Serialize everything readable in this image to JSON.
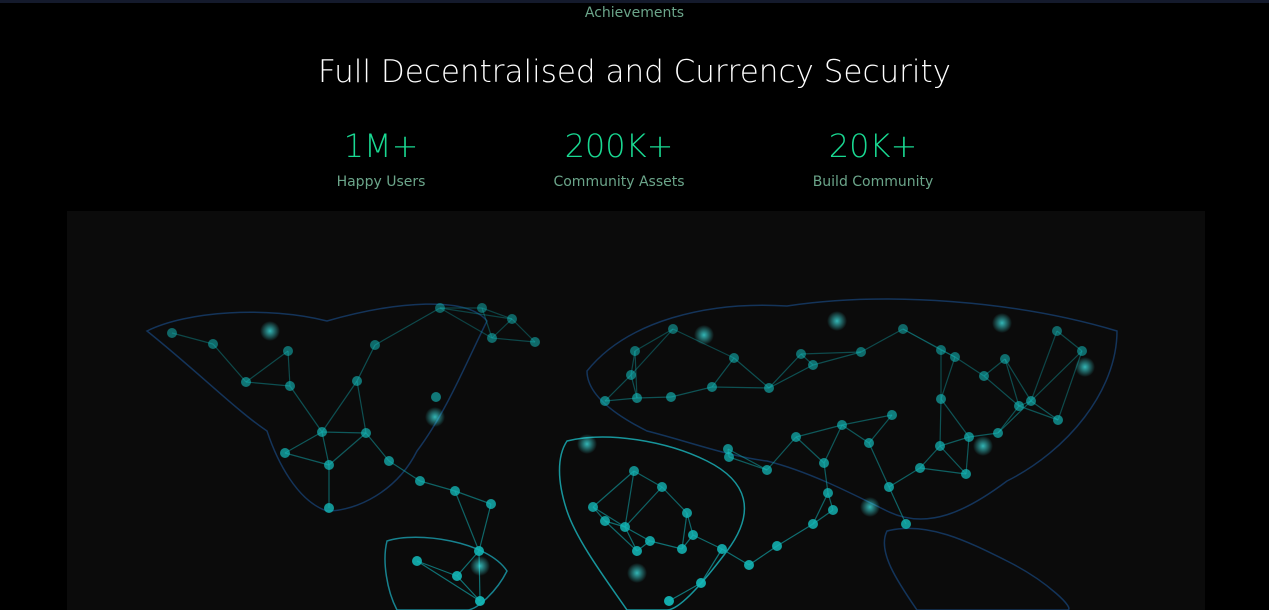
{
  "section": {
    "eyebrow": "Achievements",
    "title": "Full Decentralised and Currency Security"
  },
  "stats": [
    {
      "value": "1M+",
      "label": "Happy Users"
    },
    {
      "value": "200K+",
      "label": "Community Assets"
    },
    {
      "value": "20K+",
      "label": "Build Community"
    }
  ],
  "colors": {
    "accent": "#19d992",
    "muted": "#6ba58a",
    "network_node": "#14b8b8",
    "map_outline": "#1a4f8a"
  }
}
